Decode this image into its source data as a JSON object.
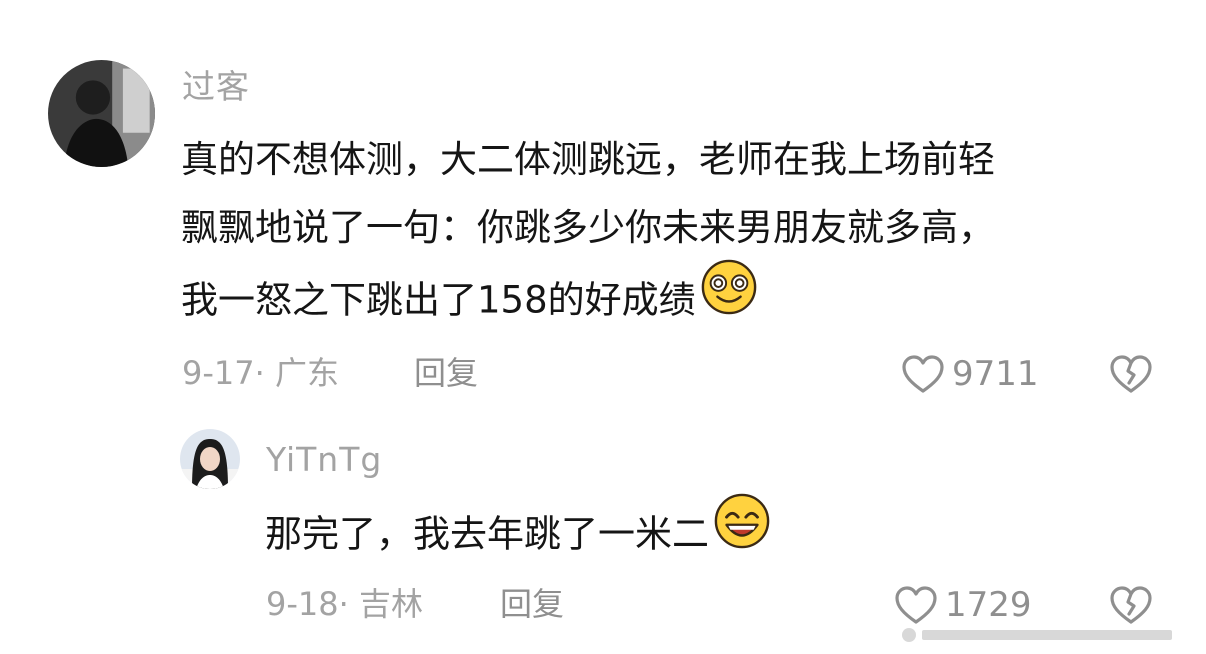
{
  "comments": [
    {
      "username": "过客",
      "lines": [
        "真的不想体测，大二体测跳远，老师在我上场前轻",
        "飘飘地说了一句：你跳多少你未来男朋友就多高，",
        "我一怒之下跳出了158的好成绩"
      ],
      "emoji": "dizzy-smile-emoji",
      "meta": "9-17· 广东",
      "reply_label": "回复",
      "likes": "9711"
    },
    {
      "username": "YiTnTg",
      "lines": [
        "那完了，我去年跳了一米二"
      ],
      "emoji": "grin-emoji",
      "meta": "9-18· 吉林",
      "reply_label": "回复",
      "likes": "1729"
    }
  ],
  "colors": {
    "text_primary": "#151515",
    "text_secondary": "#a3a3a3",
    "icon": "#8f8f8f",
    "emoji_face": "#ffd23f",
    "background": "#ffffff"
  }
}
